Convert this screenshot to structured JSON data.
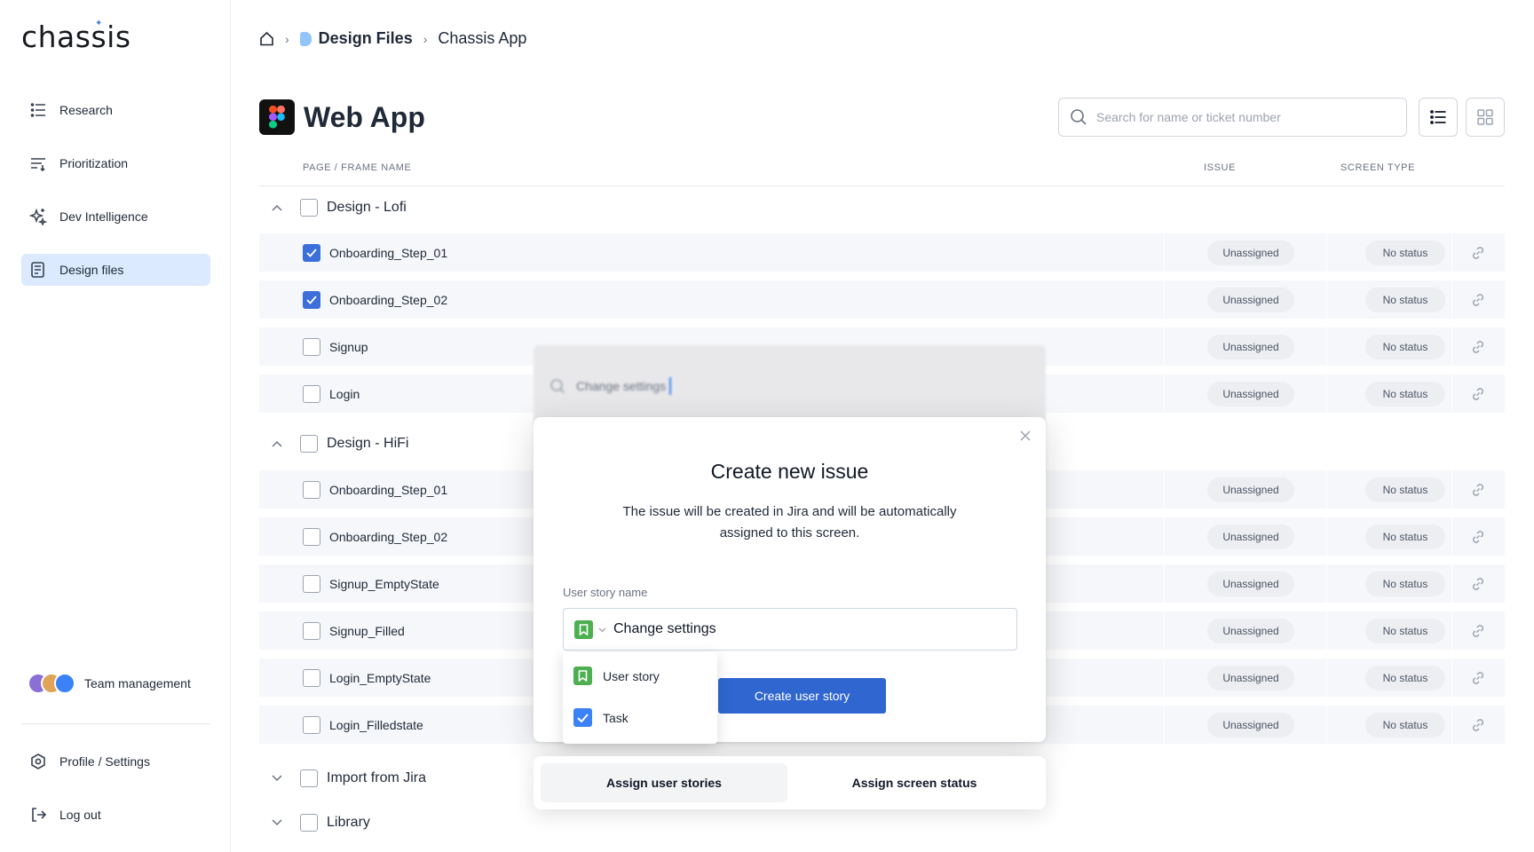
{
  "app": {
    "logo": "chassis"
  },
  "sidebar": {
    "items": [
      {
        "label": "Research",
        "icon": "list-icon"
      },
      {
        "label": "Prioritization",
        "icon": "sort-icon"
      },
      {
        "label": "Dev Intelligence",
        "icon": "sparkle-icon"
      },
      {
        "label": "Design files",
        "icon": "document-icon",
        "active": true
      }
    ],
    "team": {
      "label": "Team management"
    },
    "bottom": [
      {
        "label": "Profile / Settings",
        "icon": "gear-icon"
      },
      {
        "label": "Log out",
        "icon": "logout-icon"
      }
    ]
  },
  "breadcrumb": {
    "folder": "Design Files",
    "current": "Chassis App"
  },
  "page": {
    "title": "Web App"
  },
  "search": {
    "placeholder": "Search for name or ticket number"
  },
  "columns": {
    "name": "PAGE / FRAME NAME",
    "issue": "ISSUE",
    "type": "SCREEN TYPE"
  },
  "groups": [
    {
      "name": "Design - Lofi",
      "expanded": true,
      "rows": [
        {
          "name": "Onboarding_Step_01",
          "checked": true,
          "issue": "Unassigned",
          "status": "No status"
        },
        {
          "name": "Onboarding_Step_02",
          "checked": true,
          "issue": "Unassigned",
          "status": "No status"
        },
        {
          "name": "Signup",
          "checked": false,
          "issue": "Unassigned",
          "status": "No status"
        },
        {
          "name": "Login",
          "checked": false,
          "issue": "Unassigned",
          "status": "No status"
        }
      ]
    },
    {
      "name": "Design - HiFi",
      "expanded": true,
      "rows": [
        {
          "name": "Onboarding_Step_01",
          "checked": false,
          "issue": "Unassigned",
          "status": "No status"
        },
        {
          "name": "Onboarding_Step_02",
          "checked": false,
          "issue": "Unassigned",
          "status": "No status"
        },
        {
          "name": "Signup_EmptyState",
          "checked": false,
          "issue": "Unassigned",
          "status": "No status"
        },
        {
          "name": "Signup_Filled",
          "checked": false,
          "issue": "Unassigned",
          "status": "No status"
        },
        {
          "name": "Login_EmptyState",
          "checked": false,
          "issue": "Unassigned",
          "status": "No status"
        },
        {
          "name": "Login_Filledstate",
          "checked": false,
          "issue": "Unassigned",
          "status": "No status"
        }
      ]
    },
    {
      "name": "Import from Jira",
      "expanded": false,
      "rows": []
    },
    {
      "name": "Library",
      "expanded": false,
      "rows": []
    }
  ],
  "blurred_search": {
    "text": "Change settings"
  },
  "modal": {
    "title": "Create new issue",
    "description": "The issue will be created in Jira and will be automatically assigned to this screen.",
    "field_label": "User story name",
    "field_value": "Change settings",
    "create_label": "Create user story"
  },
  "dropdown": {
    "options": [
      {
        "label": "User story",
        "icon": "bookmark-icon"
      },
      {
        "label": "Task",
        "icon": "check-square-icon"
      }
    ]
  },
  "tabs": [
    {
      "label": "Assign user stories",
      "active": true
    },
    {
      "label": "Assign screen status",
      "active": false
    }
  ],
  "colors": {
    "accent": "#2f66cf",
    "user_story": "#4caf50",
    "task": "#3b82f6",
    "active_nav": "#dbeafe"
  }
}
